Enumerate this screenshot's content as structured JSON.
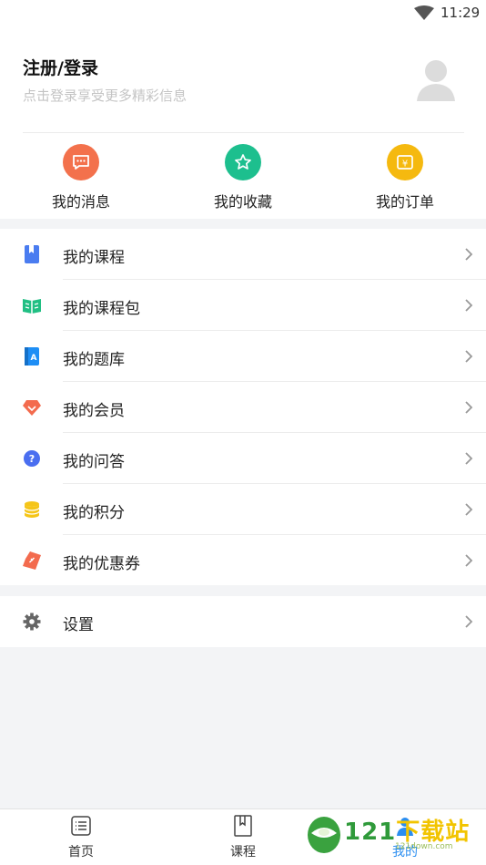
{
  "status_bar": {
    "time": "11:29",
    "icons": [
      "wifi-icon"
    ]
  },
  "profile": {
    "title": "注册/登录",
    "subtitle": "点击登录享受更多精彩信息"
  },
  "quick_actions": [
    {
      "label": "我的消息",
      "icon": "message-icon",
      "color": "#f3714c"
    },
    {
      "label": "我的收藏",
      "icon": "star-icon",
      "color": "#1dbf8e"
    },
    {
      "label": "我的订单",
      "icon": "order-icon",
      "color": "#f5b90f"
    }
  ],
  "menu": [
    {
      "label": "我的课程",
      "icon": "course-book-icon",
      "color": "#4a7cf0"
    },
    {
      "label": "我的课程包",
      "icon": "course-package-icon",
      "color": "#21bf83"
    },
    {
      "label": "我的题库",
      "icon": "question-bank-icon",
      "color": "#1e8ef5"
    },
    {
      "label": "我的会员",
      "icon": "membership-icon",
      "color": "#f36b4e"
    },
    {
      "label": "我的问答",
      "icon": "question-answer-icon",
      "color": "#4a6ef0"
    },
    {
      "label": "我的积分",
      "icon": "points-coin-icon",
      "color": "#f5c518"
    },
    {
      "label": "我的优惠券",
      "icon": "coupon-icon",
      "color": "#f36b4e"
    }
  ],
  "settings": {
    "label": "设置",
    "icon": "gear-icon"
  },
  "tab_bar": [
    {
      "label": "首页",
      "icon": "home-list-icon",
      "active": false
    },
    {
      "label": "课程",
      "icon": "course-icon",
      "active": false
    },
    {
      "label": "我的",
      "icon": "profile-icon",
      "active": true
    }
  ],
  "watermark": {
    "text_main": "121",
    "text_accent": "下载站",
    "text_sub": "121down.com"
  }
}
